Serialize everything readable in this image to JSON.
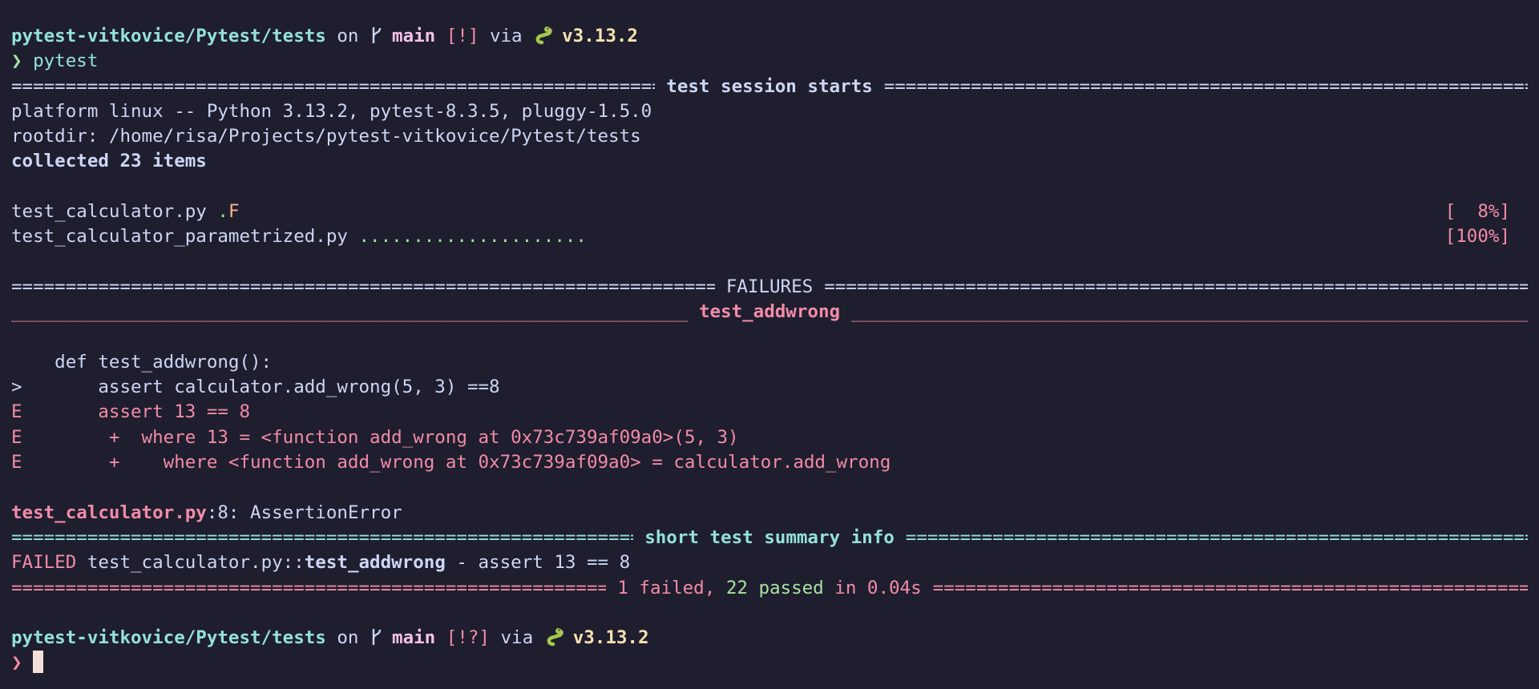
{
  "prompt1": {
    "path": "pytest-vitkovice/Pytest/tests",
    "on": "on",
    "branch": "main",
    "status": "[!]",
    "via": "via",
    "version": "v3.13.2",
    "arrow": "❯",
    "command": "pytest"
  },
  "session": {
    "header": "test session starts",
    "platform": "platform linux -- Python 3.13.2, pytest-8.3.5, pluggy-1.5.0",
    "rootdir": "rootdir: /home/risa/Projects/pytest-vitkovice/Pytest/tests",
    "collected": "collected 23 items"
  },
  "results": [
    {
      "file": "test_calculator.py",
      "pass_marks": ".",
      "fail_marks": "F",
      "progress": "[  8%]"
    },
    {
      "file": "test_calculator_parametrized.py",
      "pass_marks": ".....................",
      "fail_marks": "",
      "progress": "[100%]"
    }
  ],
  "failures": {
    "header": "FAILURES",
    "test_name": "test_addwrong",
    "code": [
      {
        "prefix": " ",
        "text": "   def test_addwrong():",
        "error": false
      },
      {
        "prefix": ">",
        "text": "       assert calculator.add_wrong(5, 3) ==8",
        "error": false
      },
      {
        "prefix": "E",
        "text": "       assert 13 == 8",
        "error": true
      },
      {
        "prefix": "E",
        "text": "        +  where 13 = <function add_wrong at 0x73c739af09a0>(5, 3)",
        "error": true
      },
      {
        "prefix": "E",
        "text": "        +    where <function add_wrong at 0x73c739af09a0> = calculator.add_wrong",
        "error": true
      }
    ],
    "location_file": "test_calculator.py",
    "location_rest": ":8: AssertionError"
  },
  "summary": {
    "header": "short test summary info",
    "failed_label": "FAILED",
    "failed_path": "test_calculator.py::",
    "failed_test": "test_addwrong",
    "failed_msg": " - assert 13 == 8",
    "failed_count": "1 failed",
    "sep": ",",
    "passed_count": "22 passed",
    "duration": "in 0.04s"
  },
  "prompt2": {
    "path": "pytest-vitkovice/Pytest/tests",
    "on": "on",
    "branch": "main",
    "status": "[!?]",
    "via": "via",
    "version": "v3.13.2",
    "arrow": "❯"
  },
  "colors": {
    "background": "#1e1e2e",
    "text": "#cdd6f4",
    "path": "#94e2d5",
    "branch": "#f5c2e7",
    "failure": "#f38ba8",
    "pass": "#a6e3a1",
    "version": "#f9e2af",
    "fail_mark": "#fab387",
    "cursor": "#f5e0dc"
  }
}
